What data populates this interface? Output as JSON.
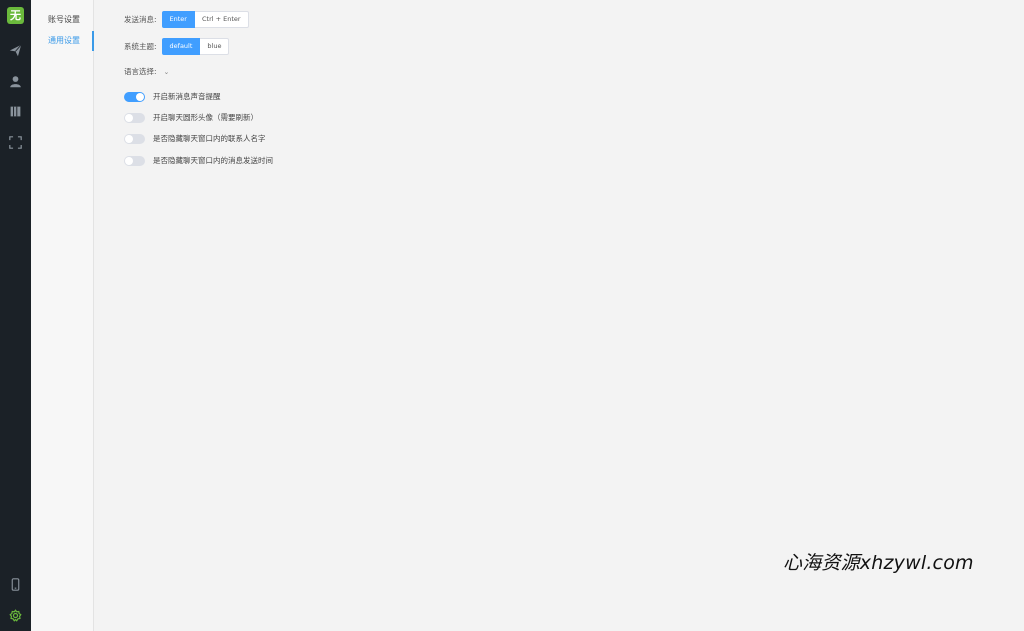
{
  "app": {
    "logo_text": "无"
  },
  "rail": {
    "icons": [
      "send-icon",
      "user-icon",
      "book-icon",
      "fullscreen-icon",
      "phone-icon",
      "settings-icon"
    ]
  },
  "subnav": {
    "items": [
      {
        "label": "账号设置",
        "active": false
      },
      {
        "label": "通用设置",
        "active": true
      }
    ]
  },
  "settings": {
    "send_message": {
      "label": "发送消息:",
      "options": [
        "Enter",
        "Ctrl + Enter"
      ],
      "selected": "Enter"
    },
    "theme": {
      "label": "系统主题:",
      "options": [
        "default",
        "blue"
      ],
      "selected": "default"
    },
    "language": {
      "label": "语言选择:"
    },
    "toggles": [
      {
        "label": "开启新消息声音提醒",
        "on": true
      },
      {
        "label": "开启聊天圆形头像（需要刷新）",
        "on": false
      },
      {
        "label": "是否隐藏聊天窗口内的联系人名字",
        "on": false
      },
      {
        "label": "是否隐藏聊天窗口内的消息发送时间",
        "on": false
      }
    ]
  },
  "watermark": "心海资源xhzywl.com",
  "colors": {
    "accent": "#409eff",
    "rail_bg": "#1b2127",
    "logo_bg": "#6ab93c"
  }
}
